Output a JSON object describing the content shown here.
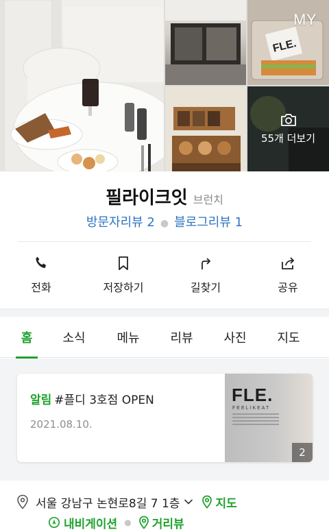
{
  "header": {
    "my_label": "MY",
    "more_photos_label": "55개 더보기"
  },
  "place": {
    "name": "필라이크잇",
    "category": "브런치",
    "visitor_reviews": "방문자리뷰 2",
    "blog_reviews": "블로그리뷰 1"
  },
  "actions": [
    {
      "label": "전화",
      "icon": "phone-icon"
    },
    {
      "label": "저장하기",
      "icon": "bookmark-icon"
    },
    {
      "label": "길찾기",
      "icon": "directions-icon"
    },
    {
      "label": "공유",
      "icon": "share-icon"
    }
  ],
  "tabs": [
    "홈",
    "소식",
    "메뉴",
    "리뷰",
    "사진",
    "지도"
  ],
  "active_tab": "홈",
  "notice": {
    "tag": "알림",
    "title": "#플디 3호점 OPEN",
    "date": "2021.08.10.",
    "thumb_logo": "FLE.",
    "thumb_sub": "FEELIKEAT",
    "thumb_count": "2"
  },
  "address": {
    "text": "서울 강남구 논현로8길 7 1층",
    "map_link": "지도",
    "navigation_link": "내비게이션",
    "distance_link": "거리뷰"
  },
  "colors": {
    "accent_green": "#1fa22e",
    "link_blue": "#2b74c2"
  }
}
